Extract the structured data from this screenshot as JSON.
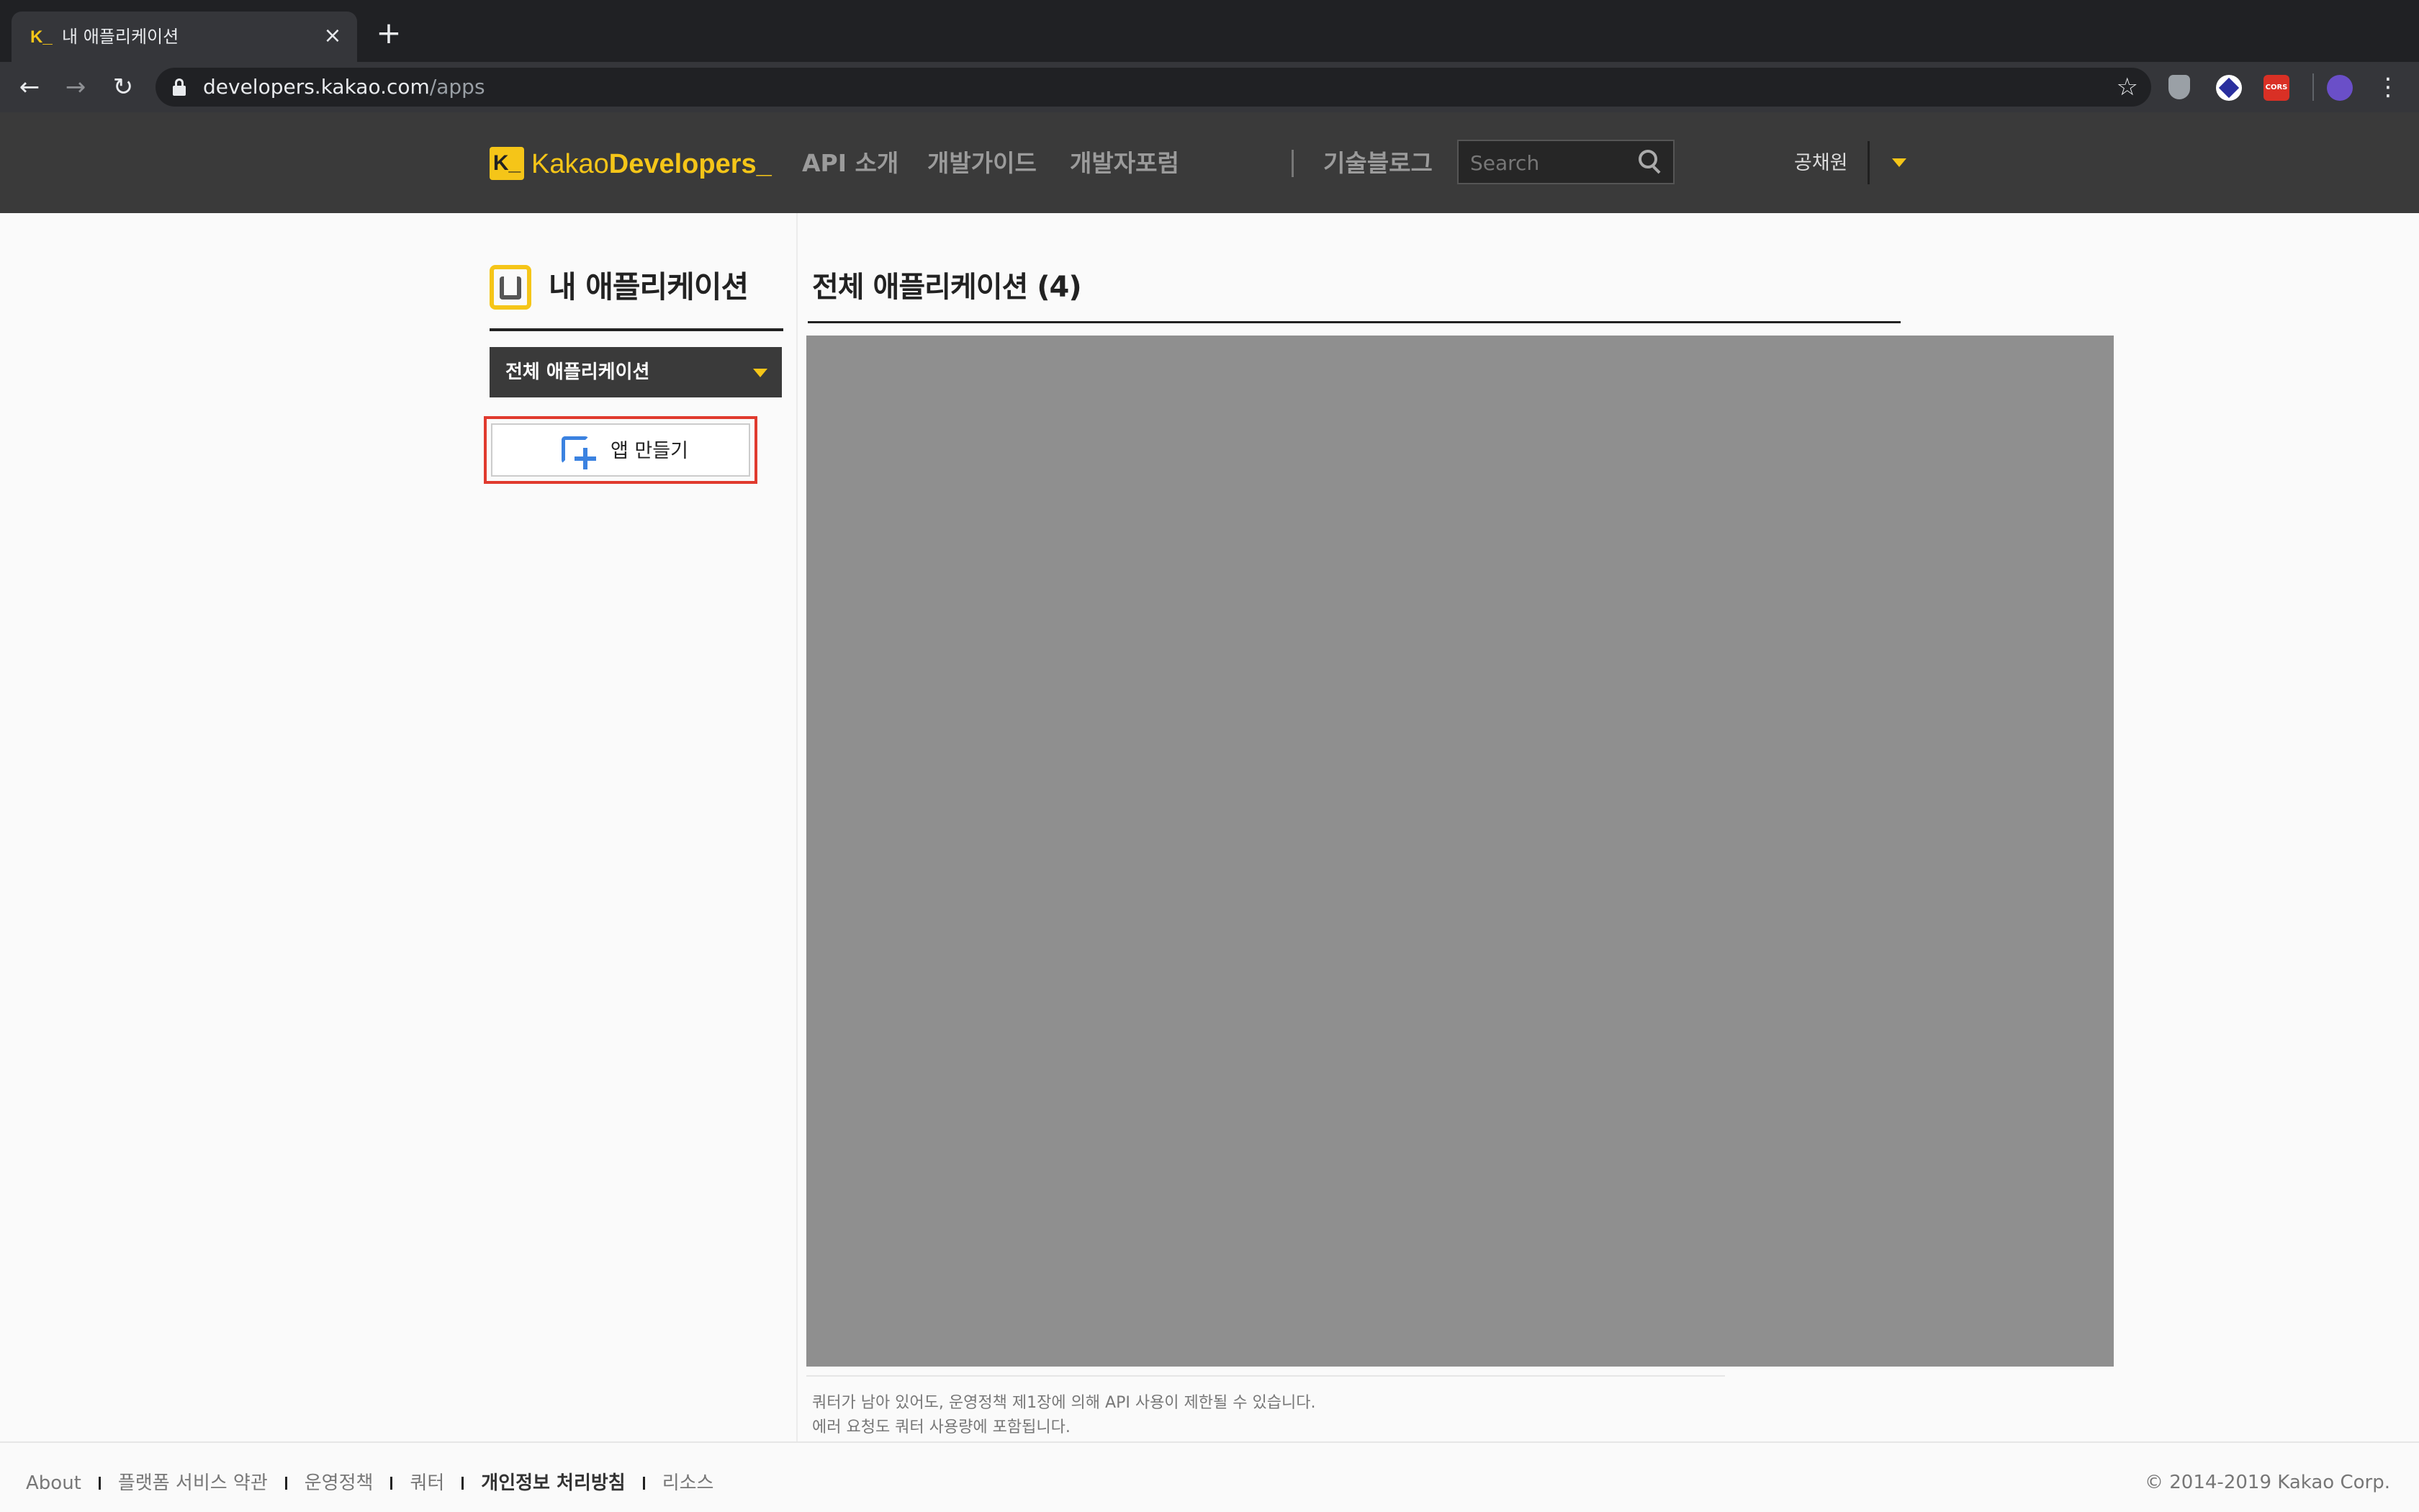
{
  "browser": {
    "tab": {
      "favicon": "K_",
      "title": "내 애플리케이션",
      "close": "×"
    },
    "new_tab": "+",
    "nav": {
      "back": "←",
      "forward": "→",
      "reload": "↻"
    },
    "url": {
      "host": "developers.kakao.com",
      "path": "/apps"
    },
    "bookmark_icon": "☆",
    "extensions": {
      "cors_label": "CORS"
    },
    "menu_icon": "⋮"
  },
  "header": {
    "logo": {
      "mark": "K_",
      "text_regular": "Kakao",
      "text_bold": "Developers",
      "underscore": "_"
    },
    "nav": [
      "API 소개",
      "개발가이드",
      "개발자포럼"
    ],
    "nav_separator": "|",
    "tech_blog": "기술블로그",
    "search": {
      "placeholder": "Search",
      "value": ""
    },
    "user": {
      "name": "공채원"
    }
  },
  "sidebar": {
    "title": "내 애플리케이션",
    "select": {
      "selected": "전체 애플리케이션"
    },
    "create_button": "앱 만들기"
  },
  "main": {
    "title": "전체 애플리케이션 (4)",
    "notice": [
      "쿼터가 남아 있어도, 운영정책 제1장에 의해 API 사용이 제한될 수 있습니다.",
      "에러 요청도 쿼터 사용량에 포함됩니다."
    ]
  },
  "footer": {
    "links": [
      "About",
      "플랫폼 서비스 약관",
      "운영정책",
      "쿼터",
      "개인정보 처리방침",
      "리소스"
    ],
    "copyright": "© 2014-2019 Kakao Corp."
  },
  "colors": {
    "accent": "#f5c518",
    "header_bg": "#3a3a3a",
    "highlight_border": "#e03a2e",
    "plus_icon": "#3b82e0",
    "panel_gray": "#8f8f8f"
  }
}
